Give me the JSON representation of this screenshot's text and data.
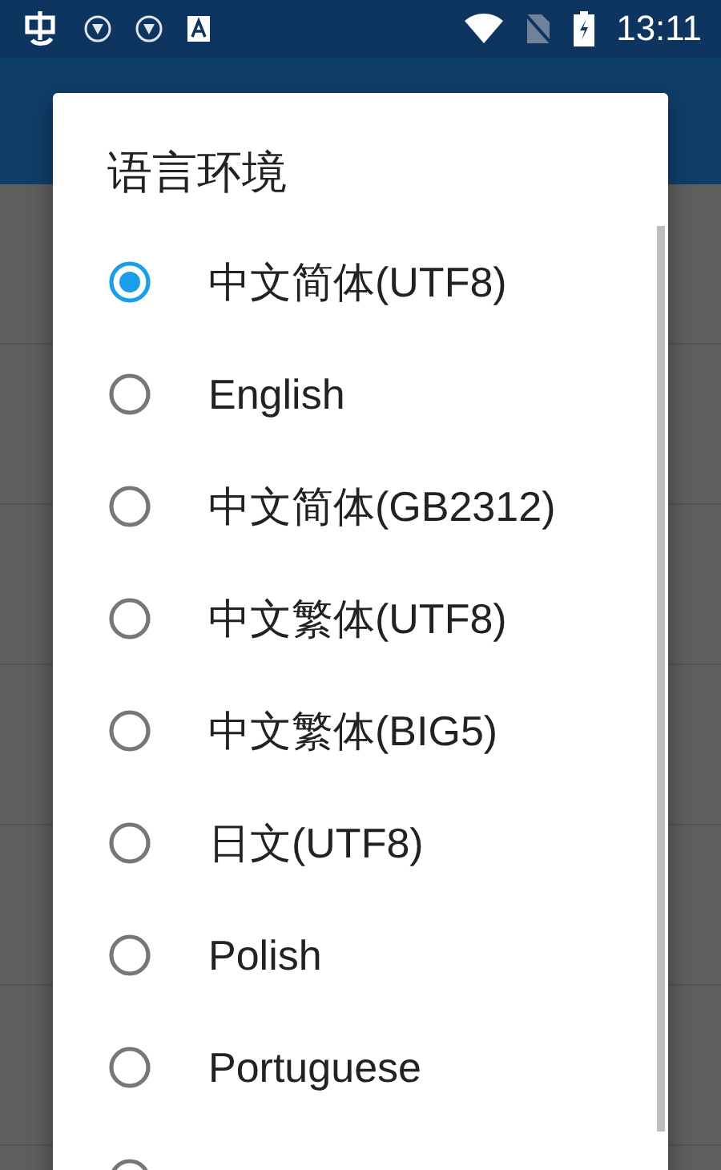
{
  "status_bar": {
    "time": "13:11"
  },
  "dialog": {
    "title": "语言环境",
    "options": [
      {
        "label": "中文简体(UTF8)",
        "selected": true
      },
      {
        "label": "English",
        "selected": false
      },
      {
        "label": "中文简体(GB2312)",
        "selected": false
      },
      {
        "label": "中文繁体(UTF8)",
        "selected": false
      },
      {
        "label": "中文繁体(BIG5)",
        "selected": false
      },
      {
        "label": "日文(UTF8)",
        "selected": false
      },
      {
        "label": "Polish",
        "selected": false
      },
      {
        "label": "Portuguese",
        "selected": false
      },
      {
        "selected": false
      }
    ]
  }
}
